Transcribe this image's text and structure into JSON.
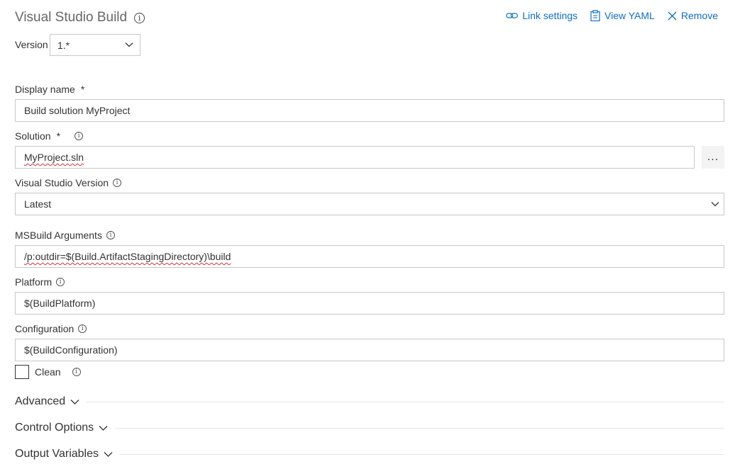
{
  "task": {
    "title": "Visual Studio Build"
  },
  "actions": {
    "link_settings": "Link settings",
    "view_yaml": "View YAML",
    "remove": "Remove"
  },
  "version": {
    "label": "Version",
    "value": "1.*"
  },
  "fields": {
    "display_name": {
      "label": "Display name",
      "required_mark": "*",
      "value": "Build solution MyProject"
    },
    "solution": {
      "label": "Solution",
      "required_mark": "*",
      "value": "MyProject.sln",
      "browse": "..."
    },
    "vs_version": {
      "label": "Visual Studio Version",
      "value": "Latest"
    },
    "msbuild_args": {
      "label": "MSBuild Arguments",
      "value": "/p:outdir=$(Build.ArtifactStagingDirectory)\\build"
    },
    "platform": {
      "label": "Platform",
      "value": "$(BuildPlatform)"
    },
    "configuration": {
      "label": "Configuration",
      "value": "$(BuildConfiguration)"
    },
    "clean": {
      "label": "Clean",
      "checked": false
    }
  },
  "sections": {
    "advanced": "Advanced",
    "control_options": "Control Options",
    "output_variables": "Output Variables"
  },
  "icons": {
    "info": "info-icon",
    "link": "link-icon",
    "clipboard": "clipboard-icon",
    "close": "close-icon",
    "chevron": "chevron-down-icon"
  },
  "colors": {
    "accent": "#106ebe",
    "text": "#333333",
    "border": "#c8c8c8",
    "spellcheck": "#d13438"
  }
}
